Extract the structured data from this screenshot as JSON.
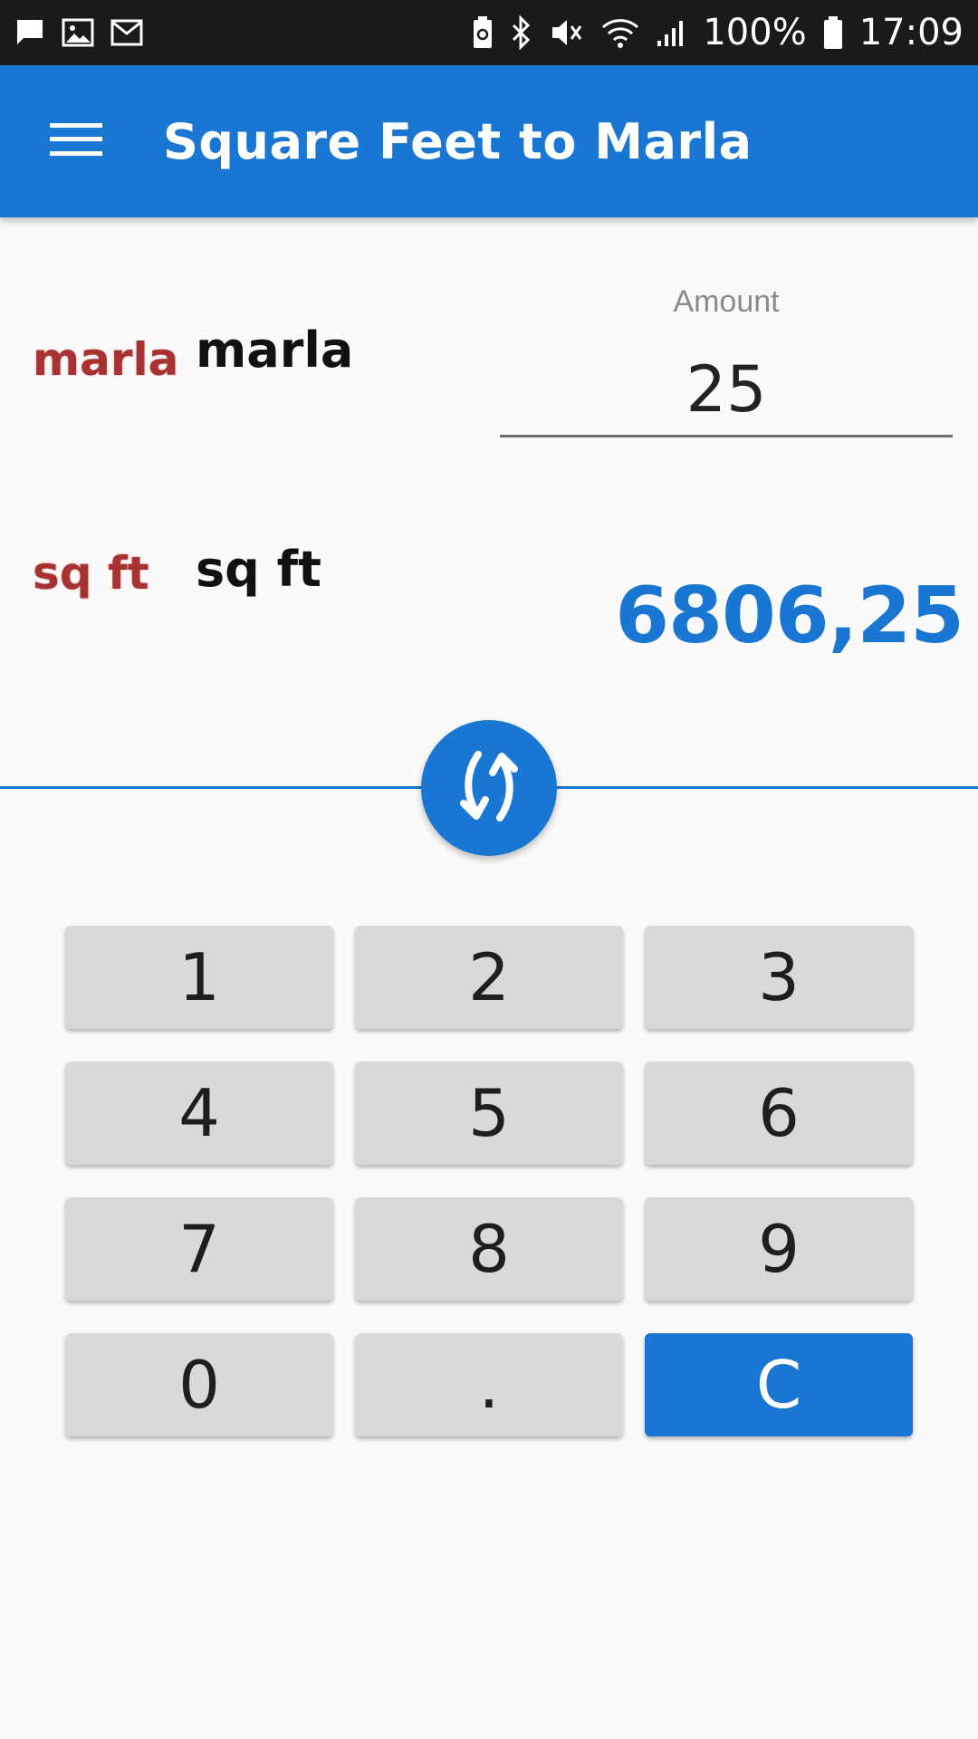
{
  "status_bar": {
    "left_icons": [
      "message-icon",
      "image-icon",
      "gmail-icon"
    ],
    "right_icons": [
      "battery-saver-icon",
      "bluetooth-icon",
      "vibrate-mute-icon",
      "wifi-icon",
      "signal-icon"
    ],
    "battery": "100%",
    "time": "17:09"
  },
  "app_bar": {
    "menu_icon": "hamburger-menu-icon",
    "title": "Square Feet to Marla"
  },
  "from_unit": {
    "logo_text": "marla",
    "name": "marla"
  },
  "amount": {
    "label": "Amount",
    "value": "25"
  },
  "to_unit": {
    "logo_text": "sq ft",
    "name": "sq ft"
  },
  "result": {
    "value": "6806,25"
  },
  "swap": {
    "icon": "swap-arrows-icon"
  },
  "keypad": {
    "keys": [
      "1",
      "2",
      "3",
      "4",
      "5",
      "6",
      "7",
      "8",
      "9",
      "0",
      ".",
      "C"
    ]
  },
  "colors": {
    "primary": "#1976d2",
    "status_bar": "#1a1a1a",
    "unit_logo": "#a83232",
    "key_background": "#d9d9d9",
    "background": "#fafafa"
  }
}
